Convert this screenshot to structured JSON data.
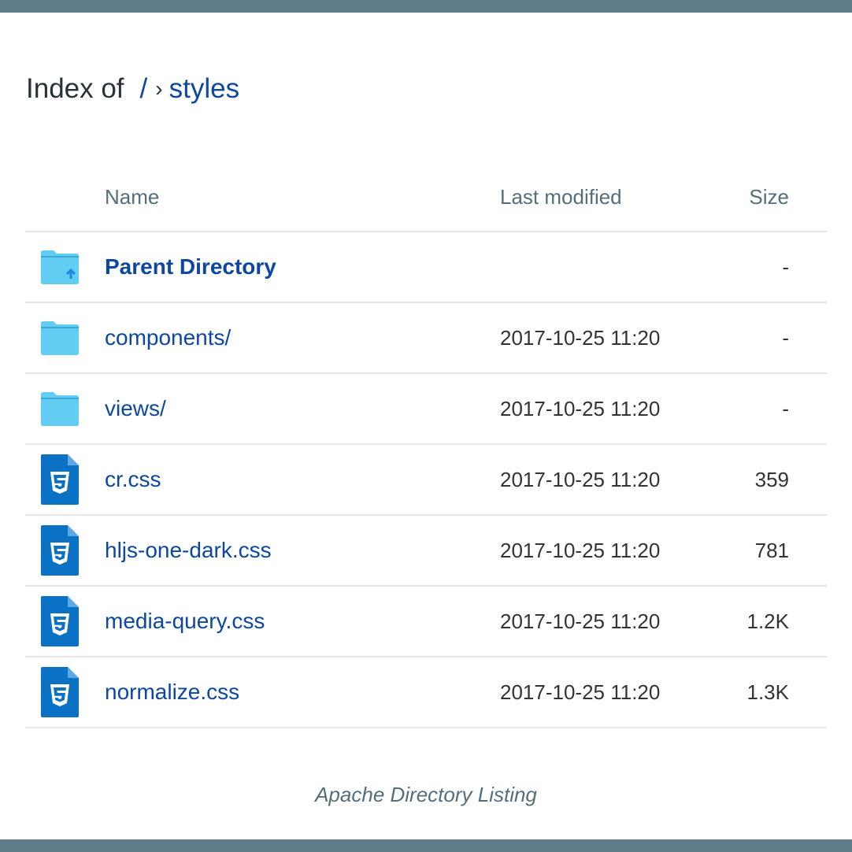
{
  "theme": {
    "bar_color": "#607d8b",
    "link_color": "#0d47a1",
    "folder_color": "#61cdf3",
    "css_icon_color": "#0b71c4"
  },
  "heading": {
    "prefix": "Index of",
    "breadcrumb": [
      {
        "label": "/"
      },
      {
        "label": "styles"
      }
    ],
    "separator": "›"
  },
  "table": {
    "columns": {
      "name": "Name",
      "modified": "Last modified",
      "size": "Size"
    },
    "rows": [
      {
        "name": "Parent Directory",
        "modified": "",
        "size": "-",
        "icon": "folder-up-icon"
      },
      {
        "name": "components/",
        "modified": "2017-10-25 11:20",
        "size": "-",
        "icon": "folder-icon"
      },
      {
        "name": "views/",
        "modified": "2017-10-25 11:20",
        "size": "-",
        "icon": "folder-icon"
      },
      {
        "name": "cr.css",
        "modified": "2017-10-25 11:20",
        "size": "359",
        "icon": "css-file-icon"
      },
      {
        "name": "hljs-one-dark.css",
        "modified": "2017-10-25 11:20",
        "size": "781",
        "icon": "css-file-icon"
      },
      {
        "name": "media-query.css",
        "modified": "2017-10-25 11:20",
        "size": "1.2K",
        "icon": "css-file-icon"
      },
      {
        "name": "normalize.css",
        "modified": "2017-10-25 11:20",
        "size": "1.3K",
        "icon": "css-file-icon"
      }
    ]
  },
  "footer": {
    "text": "Apache Directory Listing"
  }
}
